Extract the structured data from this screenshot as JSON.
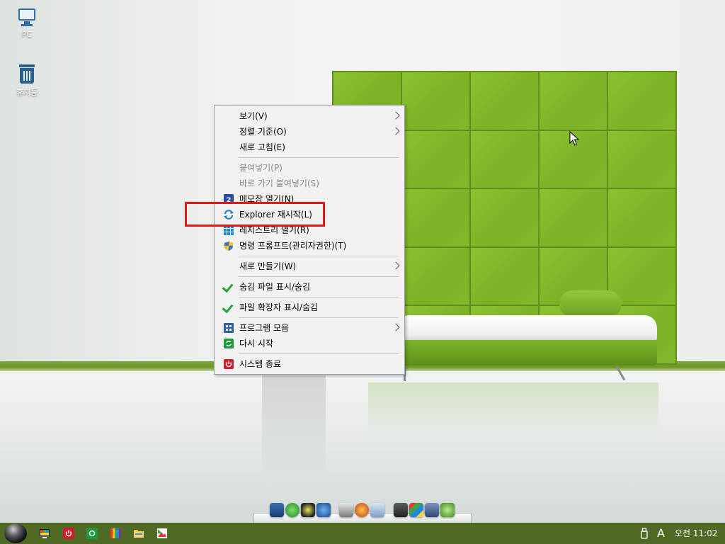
{
  "desktop": {
    "icons": [
      {
        "label": "PC",
        "icon": "monitor-icon"
      },
      {
        "label": "휴지통",
        "icon": "recycle-bin-icon"
      }
    ]
  },
  "context_menu": {
    "items": [
      {
        "label": "보기(V)",
        "submenu": true
      },
      {
        "label": "정렬 기준(O)",
        "submenu": true
      },
      {
        "label": "새로 고침(E)"
      },
      {
        "label": "붙여넣기(P)",
        "disabled": true
      },
      {
        "label": "바로 가기 붙여넣기(S)",
        "disabled": true
      },
      {
        "label": "메모장 열기(N)",
        "icon": "notepad-icon"
      },
      {
        "label": "Explorer 재시작(L)",
        "icon": "refresh-icon",
        "highlighted": true
      },
      {
        "label": "레지스트리 열기(R)",
        "icon": "registry-icon"
      },
      {
        "label": "명령 프롬프트(관리자권한)(T)",
        "icon": "admin-shield-icon"
      },
      {
        "label": "새로 만들기(W)",
        "submenu": true
      },
      {
        "label": "숨김 파일 표시/숨김",
        "checked": true
      },
      {
        "label": "파일 확장자 표시/숨김",
        "checked": true
      },
      {
        "label": "프로그램 모음",
        "icon": "programs-icon",
        "submenu": true
      },
      {
        "label": "다시 시작",
        "icon": "restart-icon"
      },
      {
        "label": "시스템 종료",
        "icon": "power-icon"
      }
    ],
    "highlight_color": "#e01919"
  },
  "taskbar": {
    "clock": "오전 11:02",
    "ime_indicator": "A",
    "color": "#4e6a25"
  },
  "colors": {
    "wallpaper_green": "#7fb52a",
    "check_green": "#24a33a"
  }
}
